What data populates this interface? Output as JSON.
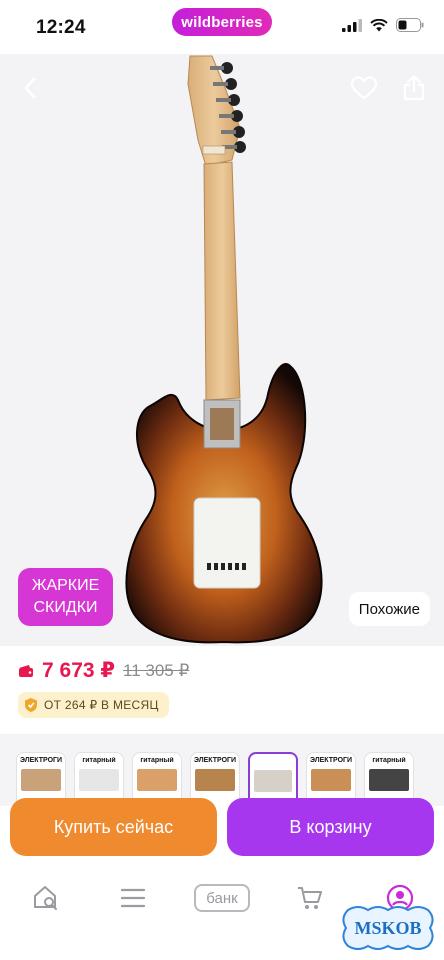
{
  "status_bar": {
    "time": "12:24",
    "brand": "wildberries"
  },
  "product": {
    "badge_line1": "ЖАРКИЕ",
    "badge_line2": "СКИДКИ",
    "similar_label": "Похожие"
  },
  "price": {
    "current": "7 673 ₽",
    "old": "11 305 ₽",
    "installment": "ОТ 264 ₽ В МЕСЯЦ"
  },
  "thumbnails": [
    {
      "label": "ЭЛЕКТРОГИТАРА",
      "selected": false
    },
    {
      "label": "гитарный",
      "selected": false
    },
    {
      "label": "гитарный",
      "selected": false
    },
    {
      "label": "ЭЛЕКТРОГИТАРА",
      "selected": false
    },
    {
      "label": "",
      "selected": true
    },
    {
      "label": "ЭЛЕКТРОГИТАРА",
      "selected": false
    },
    {
      "label": "гитарный",
      "selected": false
    }
  ],
  "actions": {
    "buy_now": "Купить сейчас",
    "add_to_cart": "В корзину"
  },
  "nav": {
    "bank": "банк"
  },
  "watermark": {
    "text": "MSKOB"
  },
  "colors": {
    "brand": "#cb2ad6",
    "price": "#e8174f",
    "buy": "#f08a2e",
    "cart": "#a737ee"
  }
}
